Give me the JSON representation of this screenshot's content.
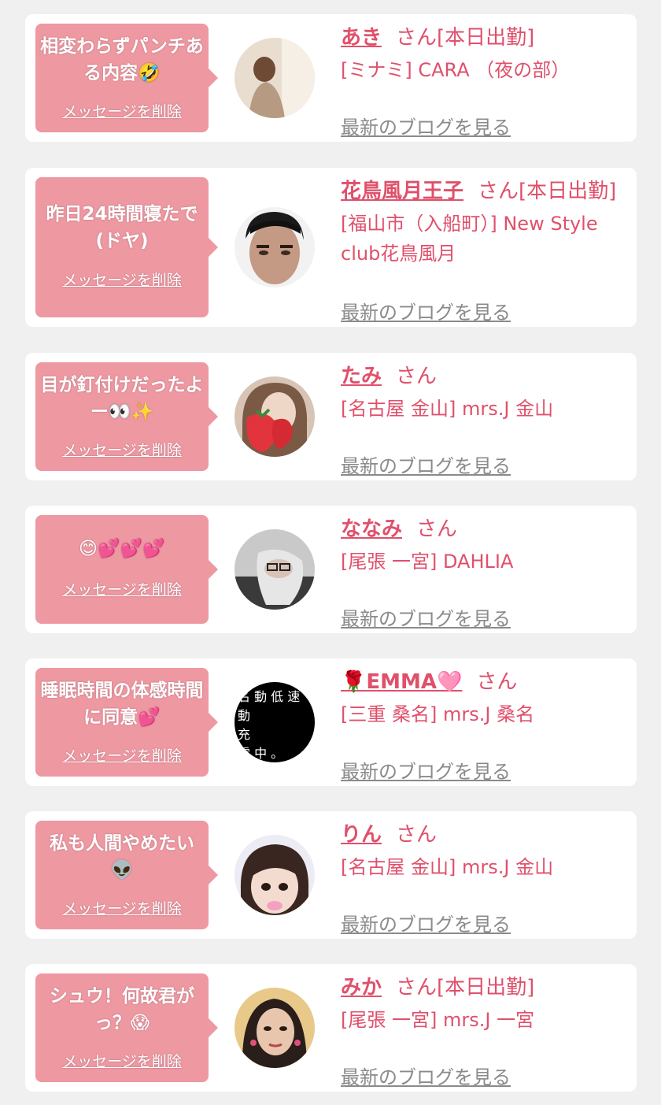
{
  "delete_label": "メッセージを削除",
  "blog_label": "最新のブログを見る",
  "san_label": "さん",
  "cards": [
    {
      "message": "相変わらずパンチある内容🤣",
      "name": "あき",
      "suffix": "さん[本日出勤]",
      "shop": "[ミナミ] CARA （夜の部）"
    },
    {
      "message": "昨日24時間寝たで(ドヤ)",
      "name": "花鳥風月王子",
      "suffix": "さん[本日出勤]",
      "shop": "[福山市（入船町）] New Style club花鳥風月"
    },
    {
      "message": "目が釘付けだったよー👀✨",
      "name": "たみ",
      "suffix": "さん",
      "shop": "[名古屋 金山] mrs.J 金山"
    },
    {
      "message": "😊💕💕💕",
      "name": "ななみ",
      "suffix": "さん",
      "shop": "[尾張 一宮] DAHLIA"
    },
    {
      "message": "睡眠時間の体感時間に同意💕",
      "name": "🌹EMMA🩷",
      "suffix": "さん",
      "shop": "[三重 桑名] mrs.J 桑名"
    },
    {
      "message": "私も人間やめたい👽",
      "name": "りん",
      "suffix": "さん",
      "shop": "[名古屋 金山] mrs.J 金山"
    },
    {
      "message": "シュウ！何故君がっ？😱",
      "name": "みか",
      "suffix": "さん[本日出勤]",
      "shop": "[尾張 一宮] mrs.J 一宮"
    }
  ]
}
